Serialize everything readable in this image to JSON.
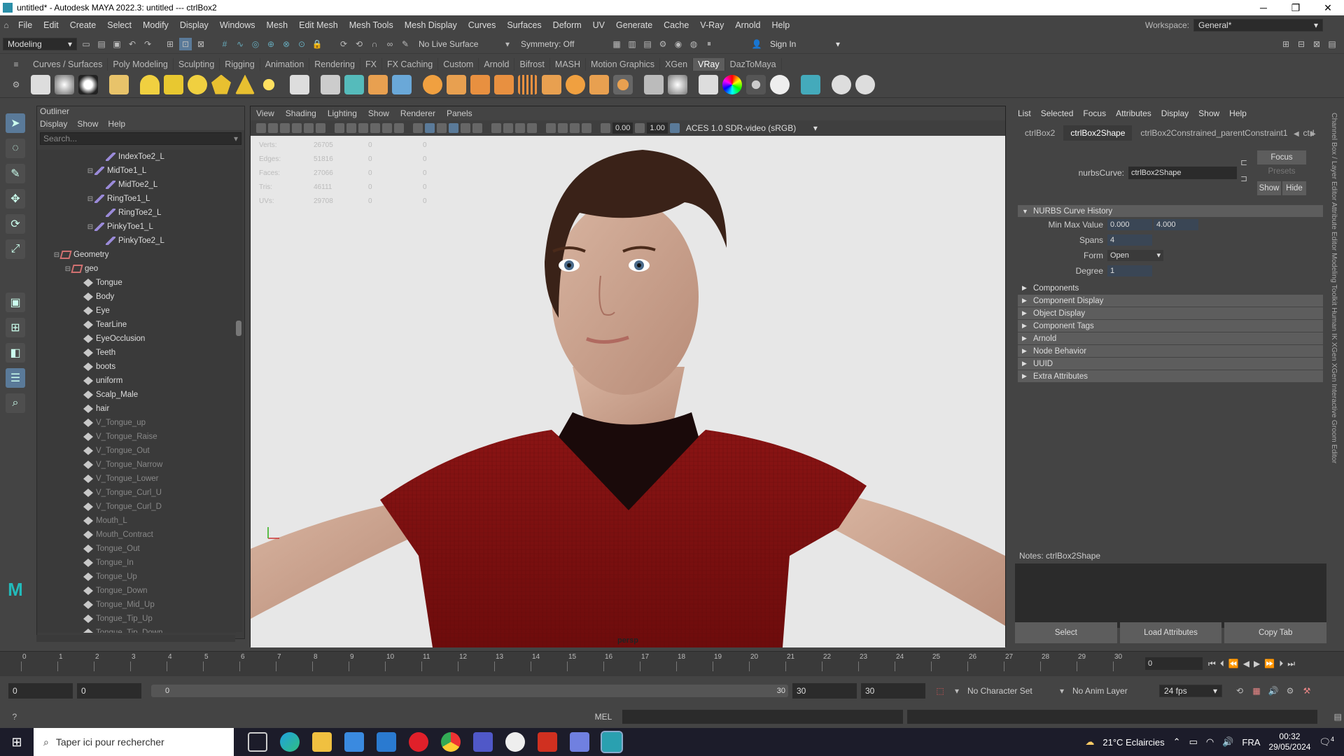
{
  "window": {
    "title": "untitled* - Autodesk MAYA 2022.3: untitled  ---  ctrlBox2",
    "min": "─",
    "max": "❐",
    "close": "✕"
  },
  "menu": [
    "File",
    "Edit",
    "Create",
    "Select",
    "Modify",
    "Display",
    "Windows",
    "Mesh",
    "Edit Mesh",
    "Mesh Tools",
    "Mesh Display",
    "Curves",
    "Surfaces",
    "Deform",
    "UV",
    "Generate",
    "Cache",
    "V-Ray",
    "Arnold",
    "Help"
  ],
  "workspace": {
    "label": "Workspace:",
    "value": "General*"
  },
  "statusline": {
    "mode": "Modeling",
    "live_surface": "No Live Surface",
    "symmetry": "Symmetry: Off",
    "sign_in": "Sign In"
  },
  "shelf_tabs": [
    "Curves / Surfaces",
    "Poly Modeling",
    "Sculpting",
    "Rigging",
    "Animation",
    "Rendering",
    "FX",
    "FX Caching",
    "Custom",
    "Arnold",
    "Bifrost",
    "MASH",
    "Motion Graphics",
    "XGen",
    "VRay",
    "DazToMaya"
  ],
  "shelf_active": "VRay",
  "outliner": {
    "title": "Outliner",
    "menu": [
      "Display",
      "Show",
      "Help"
    ],
    "search_placeholder": "Search...",
    "items": [
      {
        "label": "IndexToe2_L",
        "indent": 5,
        "type": "joint",
        "exp": ""
      },
      {
        "label": "MidToe1_L",
        "indent": 4,
        "type": "joint",
        "exp": "⊟"
      },
      {
        "label": "MidToe2_L",
        "indent": 5,
        "type": "joint",
        "exp": ""
      },
      {
        "label": "RingToe1_L",
        "indent": 4,
        "type": "joint",
        "exp": "⊟"
      },
      {
        "label": "RingToe2_L",
        "indent": 5,
        "type": "joint",
        "exp": ""
      },
      {
        "label": "PinkyToe1_L",
        "indent": 4,
        "type": "joint",
        "exp": "⊟"
      },
      {
        "label": "PinkyToe2_L",
        "indent": 5,
        "type": "joint",
        "exp": ""
      },
      {
        "label": "Geometry",
        "indent": 1,
        "type": "group",
        "exp": "⊟"
      },
      {
        "label": "geo",
        "indent": 2,
        "type": "group",
        "exp": "⊟"
      },
      {
        "label": "Tongue",
        "indent": 3,
        "type": "mesh",
        "exp": ""
      },
      {
        "label": "Body",
        "indent": 3,
        "type": "mesh",
        "exp": ""
      },
      {
        "label": "Eye",
        "indent": 3,
        "type": "mesh",
        "exp": ""
      },
      {
        "label": "TearLine",
        "indent": 3,
        "type": "mesh",
        "exp": ""
      },
      {
        "label": "EyeOcclusion",
        "indent": 3,
        "type": "mesh",
        "exp": ""
      },
      {
        "label": "Teeth",
        "indent": 3,
        "type": "mesh",
        "exp": ""
      },
      {
        "label": "boots",
        "indent": 3,
        "type": "mesh",
        "exp": ""
      },
      {
        "label": "uniform",
        "indent": 3,
        "type": "mesh",
        "exp": ""
      },
      {
        "label": "Scalp_Male",
        "indent": 3,
        "type": "mesh",
        "exp": ""
      },
      {
        "label": "hair",
        "indent": 3,
        "type": "mesh",
        "exp": ""
      },
      {
        "label": "V_Tongue_up",
        "indent": 3,
        "type": "mesh",
        "exp": "",
        "dim": true
      },
      {
        "label": "V_Tongue_Raise",
        "indent": 3,
        "type": "mesh",
        "exp": "",
        "dim": true
      },
      {
        "label": "V_Tongue_Out",
        "indent": 3,
        "type": "mesh",
        "exp": "",
        "dim": true
      },
      {
        "label": "V_Tongue_Narrow",
        "indent": 3,
        "type": "mesh",
        "exp": "",
        "dim": true
      },
      {
        "label": "V_Tongue_Lower",
        "indent": 3,
        "type": "mesh",
        "exp": "",
        "dim": true
      },
      {
        "label": "V_Tongue_Curl_U",
        "indent": 3,
        "type": "mesh",
        "exp": "",
        "dim": true
      },
      {
        "label": "V_Tongue_Curl_D",
        "indent": 3,
        "type": "mesh",
        "exp": "",
        "dim": true
      },
      {
        "label": "Mouth_L",
        "indent": 3,
        "type": "mesh",
        "exp": "",
        "dim": true
      },
      {
        "label": "Mouth_Contract",
        "indent": 3,
        "type": "mesh",
        "exp": "",
        "dim": true
      },
      {
        "label": "Tongue_Out",
        "indent": 3,
        "type": "mesh",
        "exp": "",
        "dim": true
      },
      {
        "label": "Tongue_In",
        "indent": 3,
        "type": "mesh",
        "exp": "",
        "dim": true
      },
      {
        "label": "Tongue_Up",
        "indent": 3,
        "type": "mesh",
        "exp": "",
        "dim": true
      },
      {
        "label": "Tongue_Down",
        "indent": 3,
        "type": "mesh",
        "exp": "",
        "dim": true
      },
      {
        "label": "Tongue_Mid_Up",
        "indent": 3,
        "type": "mesh",
        "exp": "",
        "dim": true
      },
      {
        "label": "Tongue_Tip_Up",
        "indent": 3,
        "type": "mesh",
        "exp": "",
        "dim": true
      },
      {
        "label": "Tongue_Tip_Down",
        "indent": 3,
        "type": "mesh",
        "exp": "",
        "dim": true
      }
    ]
  },
  "viewport": {
    "menu": [
      "View",
      "Shading",
      "Lighting",
      "Show",
      "Renderer",
      "Panels"
    ],
    "value1": "0.00",
    "value2": "1.00",
    "color_space": "ACES 1.0 SDR-video (sRGB)",
    "camera": "persp",
    "hud": [
      {
        "k": "Verts:",
        "a": "26705",
        "b": "0",
        "c": "0"
      },
      {
        "k": "Edges:",
        "a": "51816",
        "b": "0",
        "c": "0"
      },
      {
        "k": "Faces:",
        "a": "27066",
        "b": "0",
        "c": "0"
      },
      {
        "k": "Tris:",
        "a": "46111",
        "b": "0",
        "c": "0"
      },
      {
        "k": "UVs:",
        "a": "29708",
        "b": "0",
        "c": "0"
      }
    ]
  },
  "attr": {
    "menu": [
      "List",
      "Selected",
      "Focus",
      "Attributes",
      "Display",
      "Show",
      "Help"
    ],
    "tabs": [
      "ctrlBox2",
      "ctrlBox2Shape",
      "ctrlBox2Constrained_parentConstraint1",
      "ctrl"
    ],
    "node_label": "nurbsCurve:",
    "node_value": "ctrlBox2Shape",
    "focus": "Focus",
    "presets": "Presets",
    "show": "Show",
    "hide": "Hide",
    "section": "NURBS Curve History",
    "minmax_label": "Min Max Value",
    "min": "0.000",
    "max": "4.000",
    "spans_label": "Spans",
    "spans": "4",
    "form_label": "Form",
    "form": "Open",
    "degree_label": "Degree",
    "degree": "1",
    "sections": [
      "Components",
      "Component Display",
      "Object Display",
      "Component Tags",
      "Arnold",
      "Node Behavior",
      "UUID",
      "Extra Attributes"
    ],
    "notes": "Notes:  ctrlBox2Shape",
    "btn_select": "Select",
    "btn_load": "Load Attributes",
    "btn_copy": "Copy Tab"
  },
  "side_tabs": "Channel Box / Layer Editor   Attribute Editor   Modeling Toolkit   Human IK   XGen   XGen Interactive Groom Editor",
  "timeline": {
    "ticks": [
      "0",
      "1",
      "2",
      "3",
      "4",
      "5",
      "6",
      "7",
      "8",
      "9",
      "10",
      "11",
      "12",
      "13",
      "14",
      "15",
      "16",
      "17",
      "18",
      "19",
      "20",
      "21",
      "22",
      "23",
      "24",
      "25",
      "26",
      "27",
      "28",
      "29",
      "30"
    ],
    "current": "0"
  },
  "range": {
    "start": "0",
    "min": "0",
    "slider_start": "0",
    "slider_end": "30",
    "end": "30",
    "max": "30",
    "character": "No Character Set",
    "anim_layer": "No Anim Layer",
    "fps": "24 fps"
  },
  "cmd": {
    "label": "MEL"
  },
  "taskbar": {
    "search": "Taper ici pour rechercher",
    "weather": "21°C  Eclaircies",
    "lang": "FRA",
    "time": "00:32",
    "date": "29/05/2024",
    "notif": "4"
  }
}
